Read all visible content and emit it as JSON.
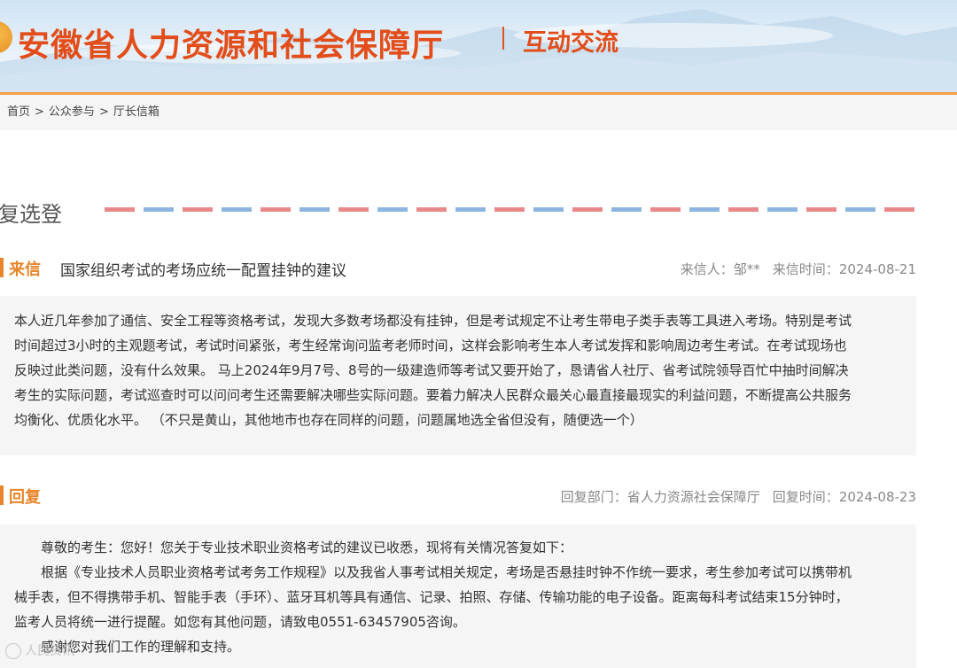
{
  "header": {
    "site_title": "安徽省人力资源和社会保障厅",
    "section": "互动交流"
  },
  "breadcrumb": [
    "首页",
    "公众参与",
    "厅长信箱"
  ],
  "breadcrumb_sep": ">",
  "page_section_title": "复选登",
  "letter": {
    "tag": "来信",
    "subject": "国家组织考试的考场应统一配置挂钟的建议",
    "sender_label": "来信人：",
    "sender": "邹**",
    "date_label": "来信时间：",
    "date": "2024-08-21",
    "body_lines": [
      "本人近几年参加了通信、安全工程等资格考试，发现大多数考场都没有挂钟，但是考试规定不让考生带电子类手表等工具进入考场。特别是考试",
      "时间超过3小时的主观题考试，考试时间紧张，考生经常询问监考老师时间，这样会影响考生本人考试发挥和影响周边考生考试。在考试现场也",
      "反映过此类问题，没有什么效果。 马上2024年9月7号、8号的一级建造师等考试又要开始了，恳请省人社厅、省考试院领导百忙中抽时间解决",
      "考生的实际问题，考试巡查时可以问问考生还需要解决哪些实际问题。要着力解决人民群众最关心最直接最现实的利益问题，不断提高公共服务",
      "均衡化、优质化水平。 （不只是黄山，其他地市也存在同样的问题，问题属地选全省但没有，随便选一个）"
    ]
  },
  "reply": {
    "tag": "回复",
    "dept_label": "回复部门：",
    "dept": "省人力资源社会保障厅",
    "date_label": "回复时间：",
    "date": "2024-08-23",
    "body_lines": [
      "尊敬的考生：您好！您关于专业技术职业资格考试的建议已收悉，现将有关情况答复如下：",
      "根据《专业技术人员职业资格考试考务工作规程》以及我省人事考试相关规定，考场是否悬挂时钟不作统一要求，考生参加考试可以携带机",
      "械手表，但不得携带手机、智能手表（手环）、蓝牙耳机等具有通信、记录、拍照、存储、传输功能的电子设备。距离每科考试结束15分钟时，",
      "监考人员将统一进行提醒。如您有其他问题，请致电0551-63457905咨询。",
      "感谢您对我们工作的理解和支持。"
    ]
  },
  "watermark": "人民资讯",
  "colors": {
    "accent": "#e24d1a",
    "tag": "#e8852a",
    "header_line": "#f0a043"
  }
}
